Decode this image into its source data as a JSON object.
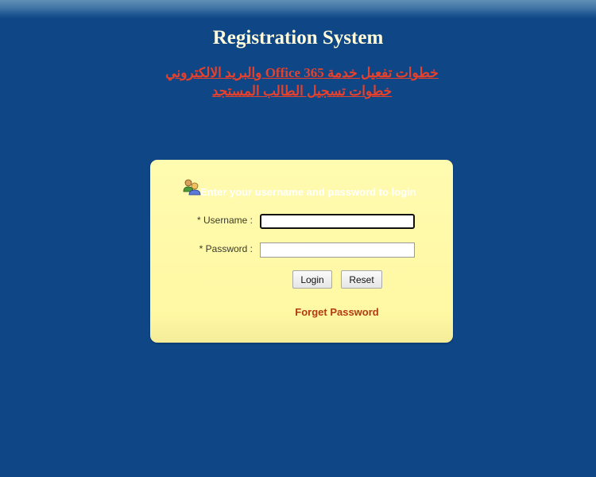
{
  "header": {
    "title": "Registration System"
  },
  "links": {
    "office365_activation": "خطوات تفعيل خدمة Office 365 والبريد الالكتروني",
    "new_student_registration": "خطوات تسجيل الطالب المستجد"
  },
  "login_form": {
    "prompt": "Enter your username and password to login",
    "username_label": "* Username :",
    "password_label": "* Password :",
    "username_value": "",
    "password_value": "",
    "login_button": "Login",
    "reset_button": "Reset",
    "forget_password_link": "Forget Password",
    "icon": "users-icon"
  },
  "colors": {
    "background": "#0e4686",
    "title_text": "#fffbd8",
    "arabic_link": "#e8402a",
    "panel_background": "#fff8a3",
    "forget_link": "#b33a12"
  }
}
